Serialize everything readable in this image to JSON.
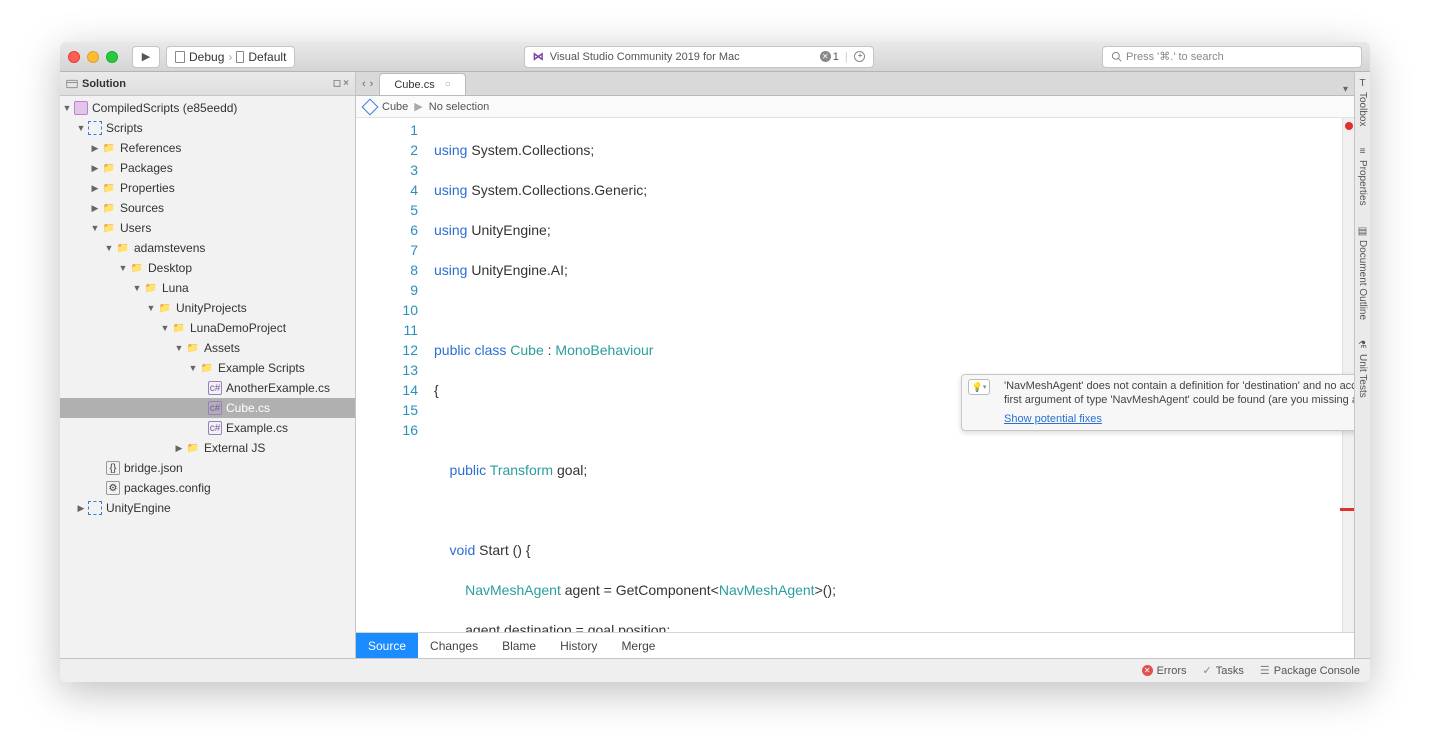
{
  "titlebar": {
    "run_icon": "▶",
    "debug_label": "Debug",
    "default_label": "Default",
    "app_title": "Visual Studio Community 2019 for Mac",
    "error_count": "1",
    "search_placeholder": "Press '⌘.' to search"
  },
  "solution": {
    "panel_title": "Solution",
    "detach": "◻",
    "close": "×",
    "tree": {
      "root": "CompiledScripts (e85eedd)",
      "scripts": "Scripts",
      "references": "References",
      "packages": "Packages",
      "properties": "Properties",
      "sources": "Sources",
      "users": "Users",
      "adamstevens": "adamstevens",
      "desktop": "Desktop",
      "luna": "Luna",
      "unityprojects": "UnityProjects",
      "lunademo": "LunaDemoProject",
      "assets": "Assets",
      "examplescripts": "Example Scripts",
      "another": "AnotherExample.cs",
      "cube": "Cube.cs",
      "example": "Example.cs",
      "externaljs": "External JS",
      "bridgejson": "bridge.json",
      "packagesconfig": "packages.config",
      "unityengine": "UnityEngine"
    }
  },
  "editor": {
    "tab_name": "Cube.cs",
    "tab_close": "○",
    "bc_cube": "Cube",
    "bc_nosel": "No selection",
    "lines": [
      "1",
      "2",
      "3",
      "4",
      "5",
      "6",
      "7",
      "8",
      "9",
      "10",
      "11",
      "12",
      "13",
      "14",
      "15",
      "16"
    ],
    "code": {
      "l1a": "using",
      "l1b": " System.Collections;",
      "l2a": "using",
      "l2b": " System.Collections.Generic;",
      "l3a": "using",
      "l3b": " UnityEngine;",
      "l4a": "using",
      "l4b": " UnityEngine.AI;",
      "l6a": "public class ",
      "l6b": "Cube",
      "l6c": " : ",
      "l6d": "MonoBehaviour",
      "l7": "{",
      "l9a": "    public ",
      "l9b": "Transform",
      "l9c": " goal;",
      "l11a": "    void ",
      "l11b": "Start",
      "l11c": " () {",
      "l12a": "        ",
      "l12b": "NavMeshAgent",
      "l12c": " agent = GetComponent<",
      "l12d": "NavMeshAgent",
      "l12e": ">();",
      "l13a": "        agent.",
      "l13b": "destination",
      "l13c": " = goal.position;",
      "l14": "    }",
      "l15": "}"
    },
    "tooltip_msg": "'NavMeshAgent' does not contain a definition for 'destination' and no accessible extension method 'destination' accepting a first argument of type 'NavMeshAgent' could be found (are you missing a using directive or an assembly reference?)",
    "tooltip_link": "Show potential fixes"
  },
  "bottom_tabs": {
    "source": "Source",
    "changes": "Changes",
    "blame": "Blame",
    "history": "History",
    "merge": "Merge"
  },
  "status": {
    "errors": "Errors",
    "tasks": "Tasks",
    "pkg": "Package Console"
  },
  "rightdock": {
    "toolbox": "Toolbox",
    "properties": "Properties",
    "outline": "Document Outline",
    "tests": "Unit Tests"
  }
}
